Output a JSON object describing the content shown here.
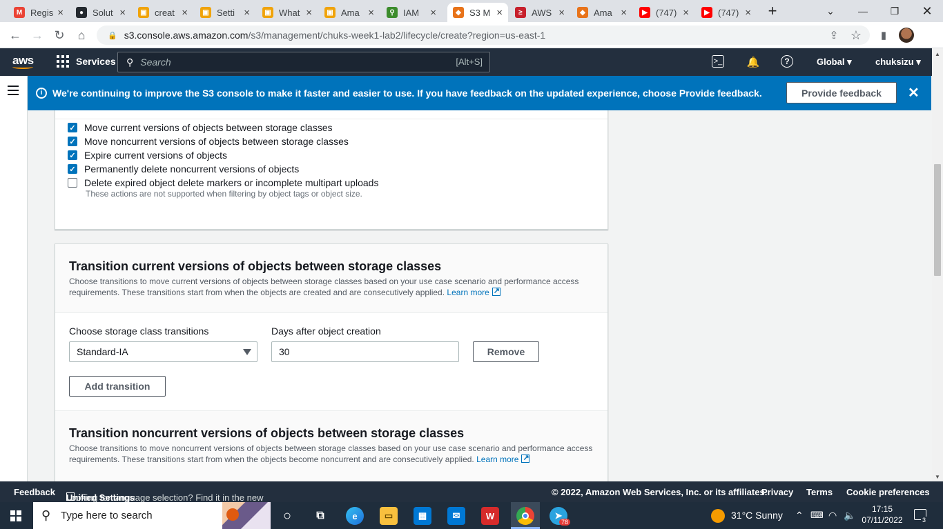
{
  "browser": {
    "tabs": [
      {
        "title": "Regis",
        "icon": "gmail-icon",
        "color": "#ea4335",
        "glyph": "M"
      },
      {
        "title": "Solut",
        "icon": "github-icon",
        "color": "#24292f",
        "glyph": "●"
      },
      {
        "title": "creat",
        "icon": "aws-docs-icon",
        "color": "#f0a30a",
        "glyph": "▣"
      },
      {
        "title": "Setti",
        "icon": "aws-docs-icon",
        "color": "#f0a30a",
        "glyph": "▣"
      },
      {
        "title": "What",
        "icon": "aws-docs-icon",
        "color": "#f0a30a",
        "glyph": "▣"
      },
      {
        "title": "Ama",
        "icon": "aws-docs-icon",
        "color": "#f0a30a",
        "glyph": "▣"
      },
      {
        "title": "IAM",
        "icon": "iam-icon",
        "color": "#3c8c2c",
        "glyph": "⚲"
      },
      {
        "title": "S3 M",
        "icon": "s3-icon",
        "color": "#e8731a",
        "glyph": "◆"
      },
      {
        "title": "AWS",
        "icon": "aws-terminal-icon",
        "color": "#c7202c",
        "glyph": "≥"
      },
      {
        "title": "Ama",
        "icon": "s3-icon",
        "color": "#e8731a",
        "glyph": "◆"
      },
      {
        "title": "(747)",
        "icon": "youtube-icon",
        "color": "#ff0000",
        "glyph": "▶"
      },
      {
        "title": "(747)",
        "icon": "youtube-icon",
        "color": "#ff0000",
        "glyph": "▶"
      }
    ],
    "active_tab": 7,
    "url_host": "s3.console.aws.amazon.com",
    "url_path": "/s3/management/chuks-week1-lab2/lifecycle/create?region=us-east-1"
  },
  "aws_nav": {
    "logo": "aws",
    "services": "Services",
    "search_placeholder": "Search",
    "search_shortcut": "[Alt+S]",
    "region": "Global",
    "user": "chuksizu"
  },
  "banner": {
    "message_prefix": "We're continuing to improve the S3 console to make it faster and easier to use. If you have feedback on the updated experience, choose ",
    "message_link": "Provide feedback",
    "message_suffix": ".",
    "button": "Provide feedback"
  },
  "rule_actions": {
    "items": [
      {
        "label": "Move current versions of objects between storage classes",
        "checked": true
      },
      {
        "label": "Move noncurrent versions of objects between storage classes",
        "checked": true
      },
      {
        "label": "Expire current versions of objects",
        "checked": true
      },
      {
        "label": "Permanently delete noncurrent versions of objects",
        "checked": true
      },
      {
        "label": "Delete expired object delete markers or incomplete multipart uploads",
        "checked": false
      }
    ],
    "note": "These actions are not supported when filtering by object tags or object size."
  },
  "transition_current": {
    "title": "Transition current versions of objects between storage classes",
    "description": "Choose transitions to move current versions of objects between storage classes based on your use case scenario and performance access requirements. These transitions start from when the objects are created and are consecutively applied.",
    "learn_more": "Learn more",
    "storage_label": "Choose storage class transitions",
    "storage_value": "Standard-IA",
    "days_label": "Days after object creation",
    "days_value": "30",
    "remove": "Remove",
    "add": "Add transition"
  },
  "transition_noncurrent": {
    "title": "Transition noncurrent versions of objects between storage classes",
    "description": "Choose transitions to move noncurrent versions of objects between storage classes based on your use case scenario and performance access requirements. These transitions start from when the objects become noncurrent and are consecutively applied.",
    "learn_more": "Learn more"
  },
  "footer": {
    "feedback": "Feedback",
    "lang_text": "Looking for language selection? Find it in the new",
    "lang_link": "Unified Settings",
    "copyright": "© 2022, Amazon Web Services, Inc. or its affiliates.",
    "privacy": "Privacy",
    "terms": "Terms",
    "cookies": "Cookie preferences"
  },
  "taskbar": {
    "search_placeholder": "Type here to search",
    "weather": "31°C  Sunny",
    "time": "17:15",
    "date": "07/11/2022",
    "telegram_badge": "78",
    "notif_count": "3"
  }
}
